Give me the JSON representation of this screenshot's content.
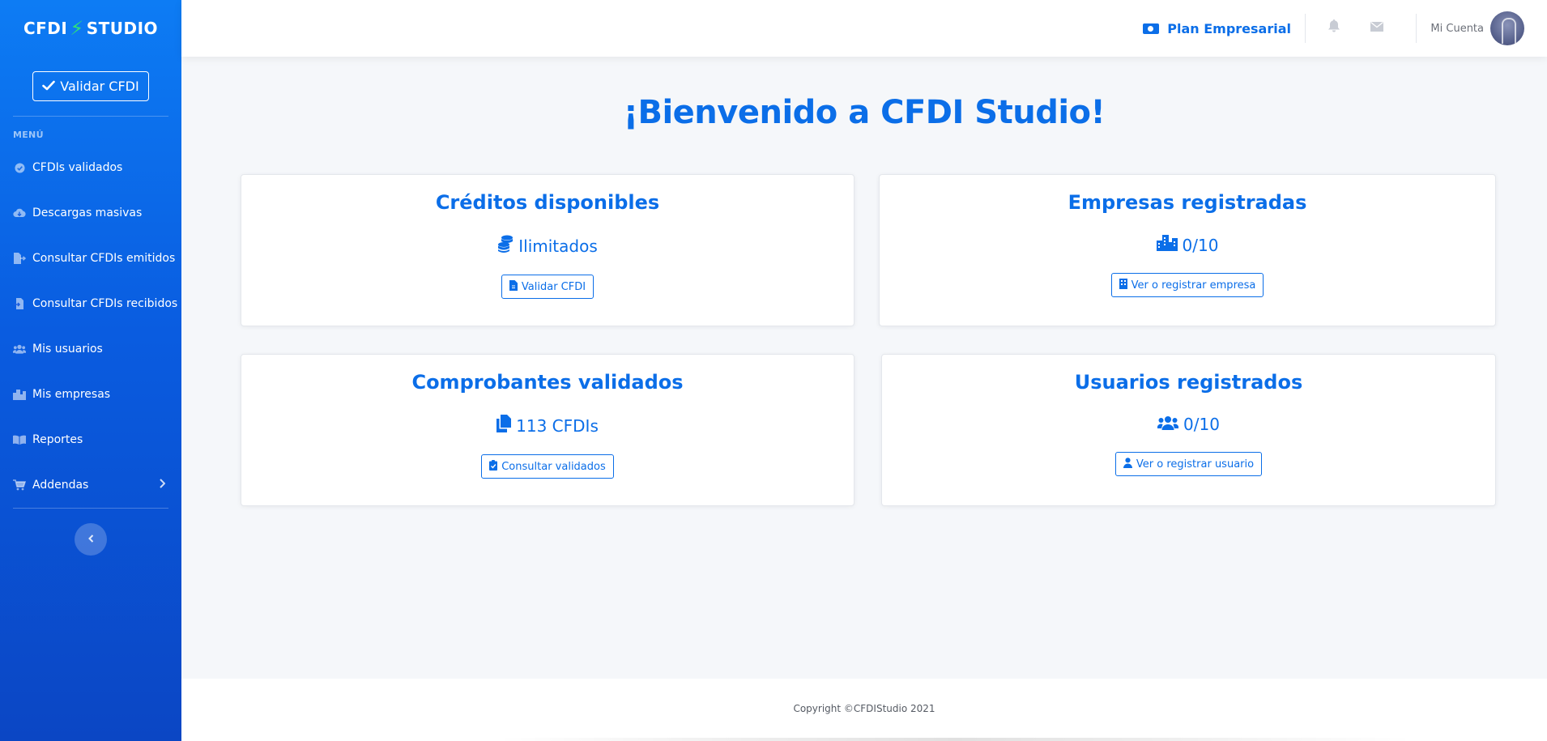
{
  "brand": {
    "part1": "CFDI",
    "bolt": "⚡",
    "part2": "STUDIO"
  },
  "sidebar": {
    "validar_label": "Validar CFDI",
    "menu_heading": "MENÚ",
    "items": [
      {
        "label": "CFDIs validados",
        "icon": "check-circle-icon"
      },
      {
        "label": "Descargas masivas",
        "icon": "cloud-download-icon"
      },
      {
        "label": "Consultar CFDIs emitidos",
        "icon": "file-export-icon"
      },
      {
        "label": "Consultar CFDIs recibidos",
        "icon": "file-import-icon"
      },
      {
        "label": "Mis usuarios",
        "icon": "users-icon"
      },
      {
        "label": "Mis empresas",
        "icon": "city-icon"
      },
      {
        "label": "Reportes",
        "icon": "book-open-icon"
      },
      {
        "label": "Addendas",
        "icon": "cart-icon"
      }
    ]
  },
  "topbar": {
    "plan_label": "Plan Empresarial",
    "account_label": "Mi Cuenta"
  },
  "main": {
    "title": "¡Bienvenido a CFDI Studio!",
    "cards": [
      {
        "title": "Créditos disponibles",
        "value": "Ilimitados",
        "icon": "coins-icon",
        "button": "Validar CFDI",
        "button_icon": "file-icon"
      },
      {
        "title": "Empresas registradas",
        "value": "0/10",
        "icon": "city-icon",
        "button": "Ver o registrar empresa",
        "button_icon": "building-icon"
      },
      {
        "title": "Comprobantes validados",
        "value": "113 CFDIs",
        "icon": "copy-icon",
        "button": "Consultar validados",
        "button_icon": "clipboard-check-icon"
      },
      {
        "title": "Usuarios registrados",
        "value": "0/10",
        "icon": "users-icon",
        "button": "Ver o registrar usuario",
        "button_icon": "user-icon"
      }
    ]
  },
  "footer": {
    "copyright": "Copyright ©CFDIStudio 2021"
  },
  "colors": {
    "accent": "#0b6ee8",
    "sidebar_top": "#0d7cf4",
    "sidebar_bottom": "#0b46c4",
    "brand_bolt": "#2ee07a",
    "page_bg": "#f5f7fa"
  }
}
